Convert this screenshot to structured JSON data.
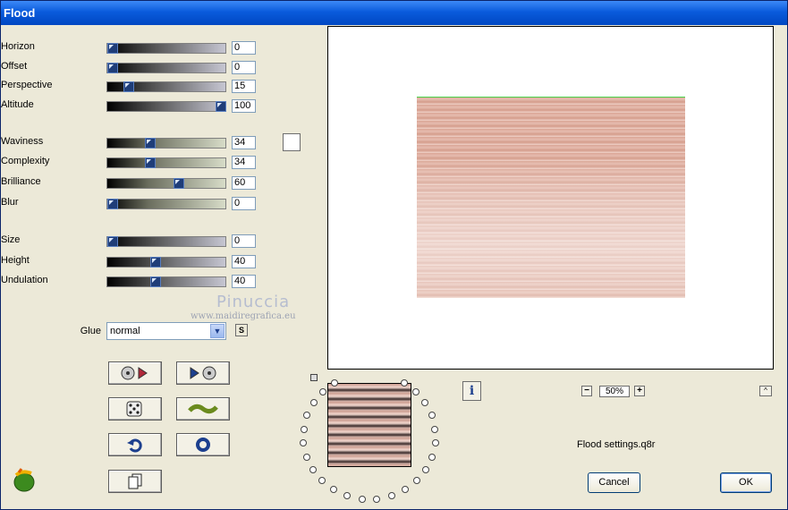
{
  "window": {
    "title": "Flood"
  },
  "params": [
    {
      "label": "Horizon",
      "value": "0",
      "level": 0
    },
    {
      "label": "Offset",
      "value": "0",
      "level": 0
    },
    {
      "label": "Perspective",
      "value": "15",
      "level": 0.15
    },
    {
      "label": "Altitude",
      "value": "100",
      "level": 1
    },
    {
      "label": "Waviness",
      "value": "34",
      "level": 0.34
    },
    {
      "label": "Complexity",
      "value": "34",
      "level": 0.34
    },
    {
      "label": "Brilliance",
      "value": "60",
      "level": 0.6
    },
    {
      "label": "Blur",
      "value": "0",
      "level": 0
    },
    {
      "label": "Size",
      "value": "0",
      "level": 0
    },
    {
      "label": "Height",
      "value": "40",
      "level": 0.4
    },
    {
      "label": "Undulation",
      "value": "40",
      "level": 0.4
    }
  ],
  "watermark": {
    "name": "Pinuccia",
    "site": "www.maidiregrafica.eu"
  },
  "glue": {
    "label": "Glue",
    "value": "normal",
    "s_label": "S"
  },
  "zoom": {
    "value": "50%"
  },
  "preset": {
    "filename": "Flood settings.q8r"
  },
  "buttons": {
    "cancel": "Cancel",
    "ok": "OK"
  },
  "colors": {
    "title_bar": "#0a5bdc",
    "water": "#dba899",
    "bg": "#ece9d8"
  }
}
